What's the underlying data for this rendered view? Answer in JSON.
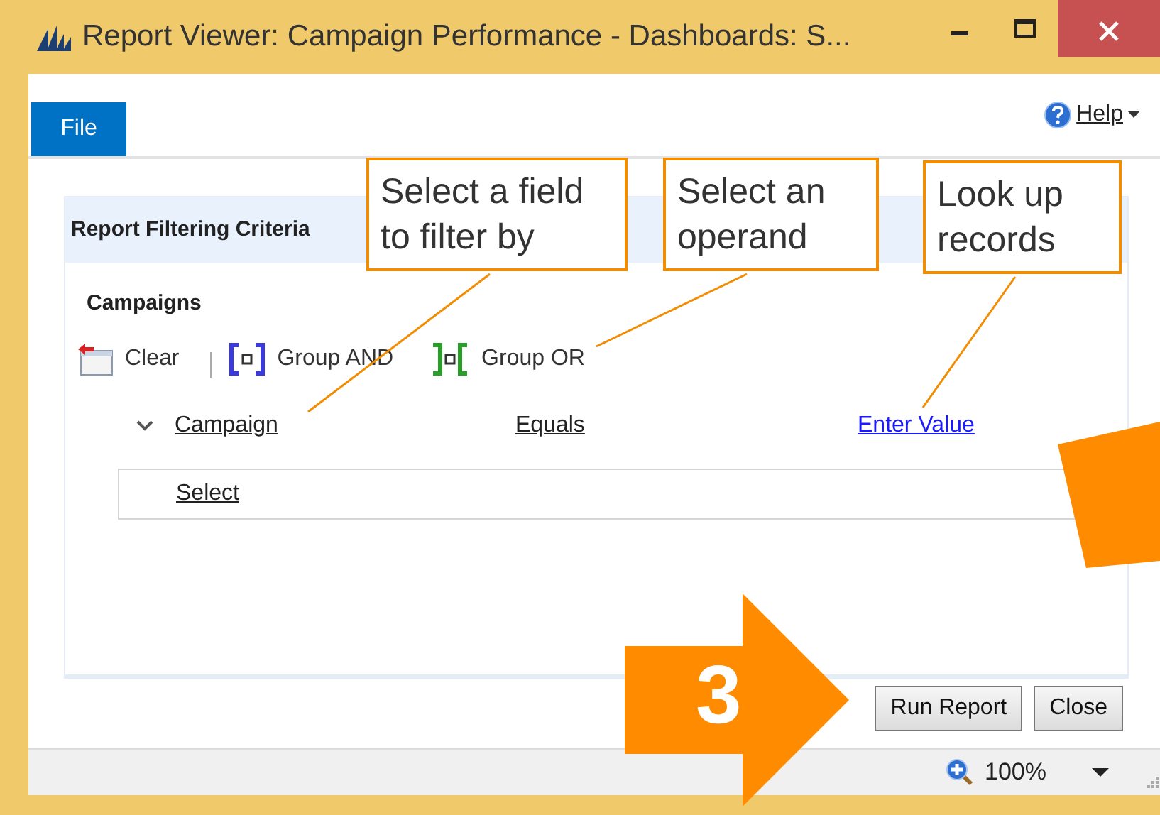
{
  "window": {
    "title": "Report Viewer: Campaign Performance - Dashboards: S..."
  },
  "menu": {
    "tabs": [
      {
        "label": "File",
        "selected": true
      }
    ],
    "help": "Help"
  },
  "panel": {
    "title": "Report Filtering Criteria",
    "section": "Campaigns",
    "toolbar": [
      {
        "kind": "clear",
        "label": "Clear"
      },
      {
        "kind": "separator"
      },
      {
        "kind": "and",
        "label": "Group AND"
      },
      {
        "kind": "or",
        "label": "Group OR"
      }
    ],
    "criteria": {
      "field": "Campaign",
      "operator": "Equals",
      "value": "Enter Value"
    },
    "select_row": "Select"
  },
  "buttons": [
    "Run Report",
    "Close"
  ],
  "status_bar": {
    "zoom": "100%"
  },
  "annotations": {
    "callouts": [
      {
        "text": "Select a field to filter by"
      },
      {
        "text": "Select an operand"
      },
      {
        "text": "Look up records"
      }
    ],
    "step": "3"
  }
}
